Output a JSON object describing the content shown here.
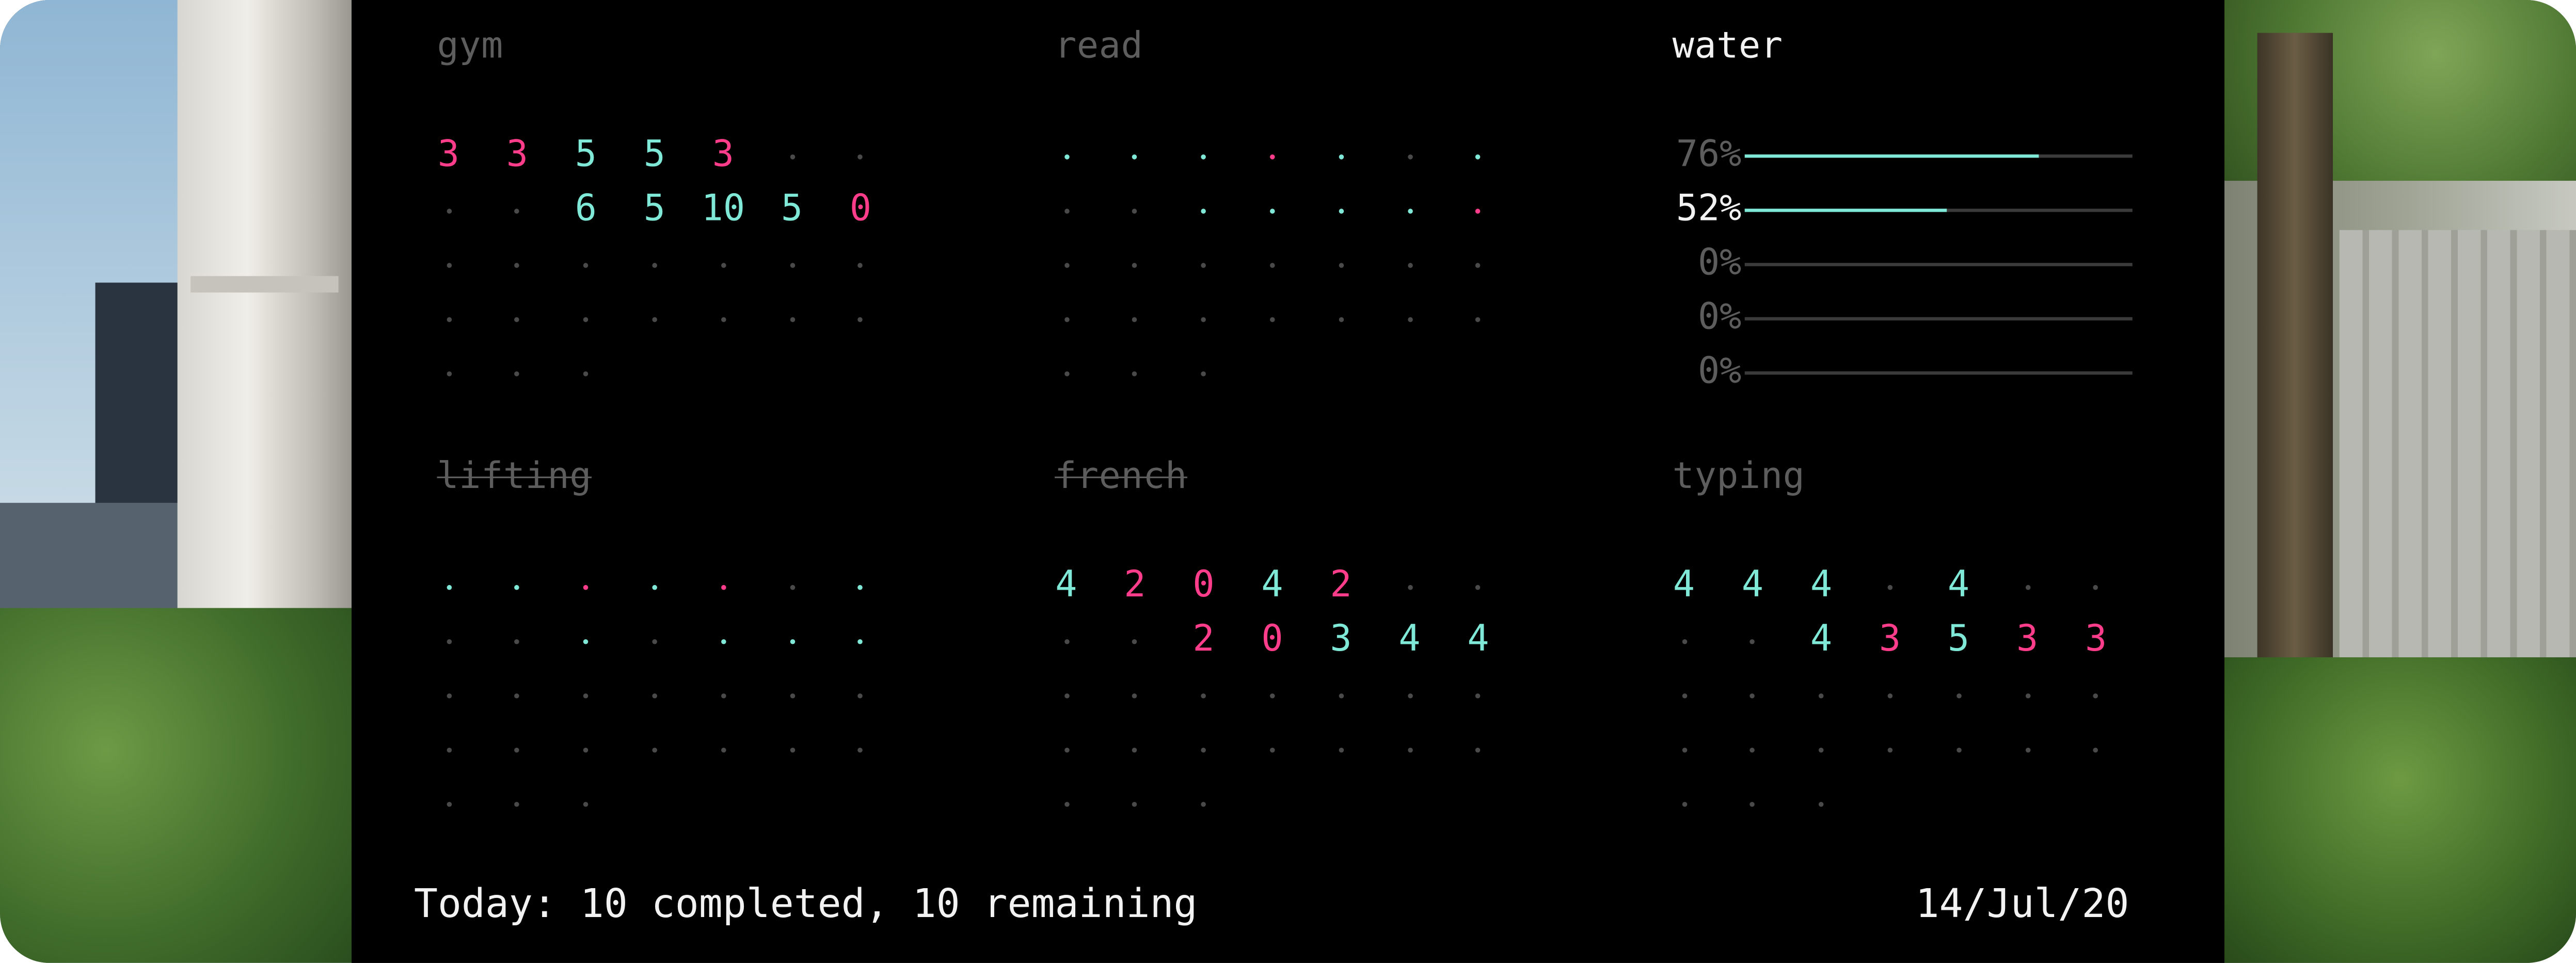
{
  "colors": {
    "good": "#7fe8d6",
    "bad": "#ff3d8b",
    "empty": "#4a4a4a",
    "muted": "#5d5d5d",
    "text": "#f2f2f2"
  },
  "habits": [
    {
      "id": "gym",
      "title": "gym",
      "active": false,
      "done": false,
      "cells": [
        [
          "3b",
          "3b",
          "5g",
          "5g",
          "3b",
          ".",
          "."
        ],
        [
          ".",
          ".",
          "6g",
          "5g",
          "10g",
          "5g",
          "0b"
        ],
        [
          ".",
          ".",
          ".",
          ".",
          ".",
          ".",
          "."
        ],
        [
          ".",
          ".",
          ".",
          ".",
          ".",
          ".",
          "."
        ],
        [
          ".",
          ".",
          "."
        ]
      ]
    },
    {
      "id": "read",
      "title": "read",
      "active": false,
      "done": false,
      "cells": [
        [
          ".g",
          ".g",
          ".g",
          ".b",
          ".g",
          ".",
          ".g"
        ],
        [
          ".",
          ".",
          ".g",
          ".g",
          ".g",
          ".g",
          ".b"
        ],
        [
          ".",
          ".",
          ".",
          ".",
          ".",
          ".",
          "."
        ],
        [
          ".",
          ".",
          ".",
          ".",
          ".",
          ".",
          "."
        ],
        [
          ".",
          ".",
          "."
        ]
      ]
    },
    {
      "id": "lifting",
      "title": "lifting",
      "active": false,
      "done": true,
      "cells": [
        [
          ".g",
          ".g",
          ".b",
          ".g",
          ".b",
          ".",
          ".g"
        ],
        [
          ".",
          ".",
          ".g",
          ".",
          ".g",
          ".g",
          ".g"
        ],
        [
          ".",
          ".",
          ".",
          ".",
          ".",
          ".",
          "."
        ],
        [
          ".",
          ".",
          ".",
          ".",
          ".",
          ".",
          "."
        ],
        [
          ".",
          ".",
          "."
        ]
      ]
    },
    {
      "id": "french",
      "title": "french",
      "active": false,
      "done": true,
      "cells": [
        [
          "4g",
          "2b",
          "0b",
          "4g",
          "2b",
          ".",
          "."
        ],
        [
          ".",
          ".",
          "2b",
          "0b",
          "3g",
          "4g",
          "4g"
        ],
        [
          ".",
          ".",
          ".",
          ".",
          ".",
          ".",
          "."
        ],
        [
          ".",
          ".",
          ".",
          ".",
          ".",
          ".",
          "."
        ],
        [
          ".",
          ".",
          "."
        ]
      ]
    },
    {
      "id": "typing",
      "title": "typing",
      "active": false,
      "done": false,
      "cells": [
        [
          "4g",
          "4g",
          "4g",
          ".",
          "4g",
          ".",
          "."
        ],
        [
          ".",
          ".",
          "4g",
          "3b",
          "5g",
          "3b",
          "3b"
        ],
        [
          ".",
          ".",
          ".",
          ".",
          ".",
          ".",
          "."
        ],
        [
          ".",
          ".",
          ".",
          ".",
          ".",
          ".",
          "."
        ],
        [
          ".",
          ".",
          "."
        ]
      ]
    }
  ],
  "water": {
    "title": "water",
    "rows": [
      {
        "label": "76%",
        "value": 0.76,
        "active": false
      },
      {
        "label": "52%",
        "value": 0.52,
        "active": true
      },
      {
        "label": "0%",
        "value": 0,
        "active": false
      },
      {
        "label": "0%",
        "value": 0,
        "active": false
      },
      {
        "label": "0%",
        "value": 0,
        "active": false
      }
    ]
  },
  "footer": {
    "summary": "Today: 10 completed, 10 remaining",
    "date": "14/Jul/20"
  }
}
